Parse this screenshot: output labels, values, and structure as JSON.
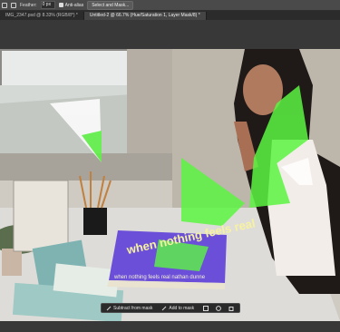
{
  "options_bar": {
    "feather_label": "Feather:",
    "feather_value": "0 px",
    "antialias_label": "Anti-alias",
    "select_mask_label": "Select and Mask..."
  },
  "tabs": [
    {
      "label": "IMG_2347.psd @ 8.33% (RGB/8*) *"
    },
    {
      "label": "Untitled-2 @ 66.7% (Hue/Saturation 1, Layer Mask/8) *"
    }
  ],
  "book": {
    "cover_title": "when nothing feels real",
    "spine_text": "when nothing feels real nathan dunne"
  },
  "contextual_bar": {
    "subtract_label": "Subtract from mask",
    "add_label": "Add to mask",
    "more_label": "···"
  },
  "colors": {
    "mask_green": "#5cf542",
    "book_purple": "#6b4fd8"
  }
}
